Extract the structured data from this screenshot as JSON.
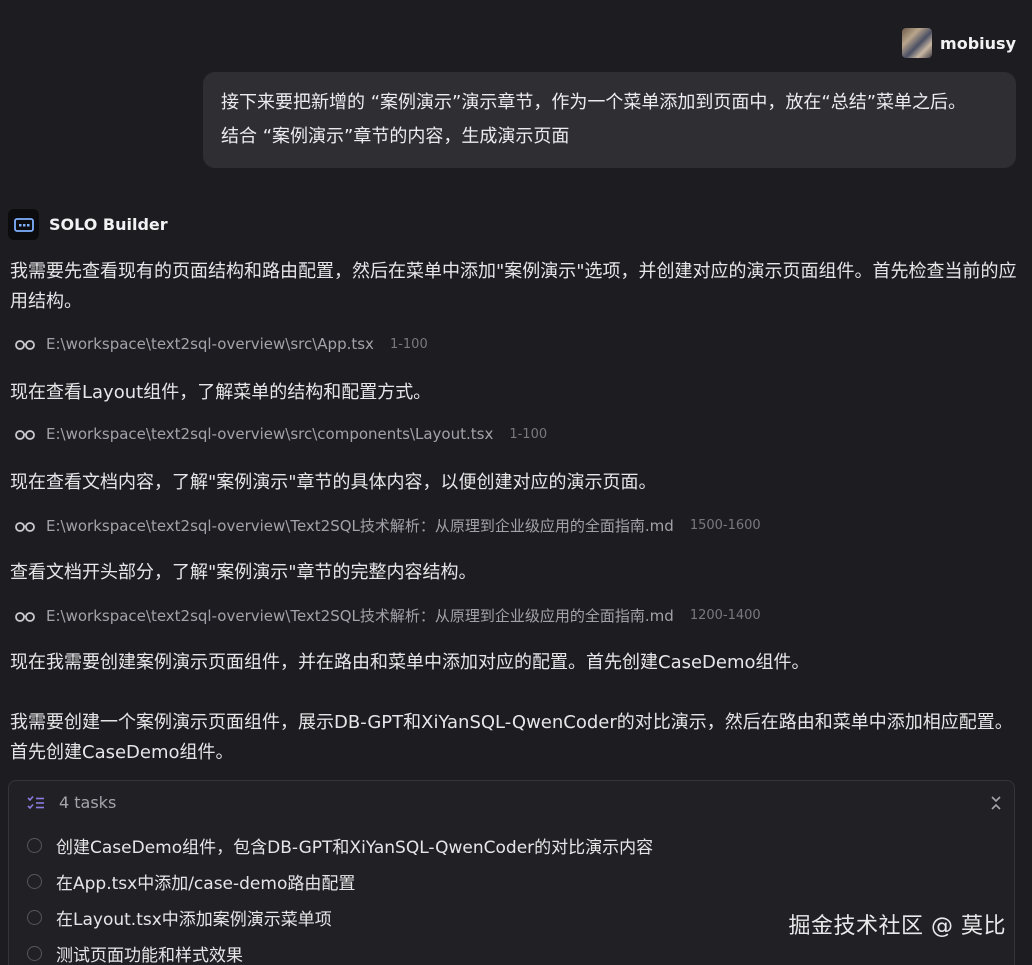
{
  "user": {
    "name": "mobiusy",
    "message_lines": [
      "接下来要把新增的 “案例演示”演示章节，作为一个菜单添加到页面中，放在“总结”菜单之后。",
      "结合 “案例演示”章节的内容，生成演示页面"
    ]
  },
  "bot": {
    "name": "SOLO Builder",
    "messages": [
      "我需要先查看现有的页面结构和路由配置，然后在菜单中添加\"案例演示\"选项，并创建对应的演示页面组件。首先检查当前的应用结构。",
      "现在查看Layout组件，了解菜单的结构和配置方式。",
      "现在查看文档内容，了解\"案例演示\"章节的具体内容，以便创建对应的演示页面。",
      "查看文档开头部分，了解\"案例演示\"章节的完整内容结构。",
      "现在我需要创建案例演示页面组件，并在路由和菜单中添加对应的配置。首先创建CaseDemo组件。",
      "我需要创建一个案例演示页面组件，展示DB-GPT和XiYanSQL-QwenCoder的对比演示，然后在路由和菜单中添加相应配置。首先创建CaseDemo组件。"
    ],
    "file_refs": [
      {
        "path": "E:\\workspace\\text2sql-overview\\src\\App.tsx",
        "range": "1-100"
      },
      {
        "path": "E:\\workspace\\text2sql-overview\\src\\components\\Layout.tsx",
        "range": "1-100"
      },
      {
        "path": "E:\\workspace\\text2sql-overview\\Text2SQL技术解析：从原理到企业级应用的全面指南.md",
        "range": "1500-1600"
      },
      {
        "path": "E:\\workspace\\text2sql-overview\\Text2SQL技术解析：从原理到企业级应用的全面指南.md",
        "range": "1200-1400"
      }
    ]
  },
  "tasks": {
    "count_label": "4 tasks",
    "items": [
      "创建CaseDemo组件，包含DB-GPT和XiYanSQL-QwenCoder的对比演示内容",
      "在App.tsx中添加/case-demo路由配置",
      "在Layout.tsx中添加案例演示菜单项",
      "测试页面功能和样式效果"
    ]
  },
  "watermark": "掘金技术社区 @ 莫比",
  "colors": {
    "background": "#1d1d21",
    "bubble": "#2e2e33",
    "task_icon": "#8b7be0"
  }
}
